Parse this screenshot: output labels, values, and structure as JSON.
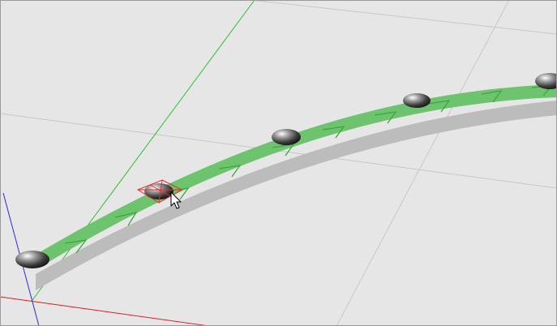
{
  "viewport": {
    "background": "#e6e6e6",
    "grid_color": "#c8c8c8",
    "axis_colors": {
      "x": "#e21b1b",
      "y": "#2fbf2f",
      "z": "#2a2ae0"
    }
  },
  "path": {
    "fill_color": "#6ec46e",
    "shadow_color": "#bcbcbc",
    "chevron_color": "#3aa83a",
    "direction_glyph": "chevron-right"
  },
  "control_points": {
    "count": 5,
    "selected_index": 1,
    "selected_marker_color": "#e03030"
  },
  "cursor": {
    "icon": "arrow-cursor"
  }
}
